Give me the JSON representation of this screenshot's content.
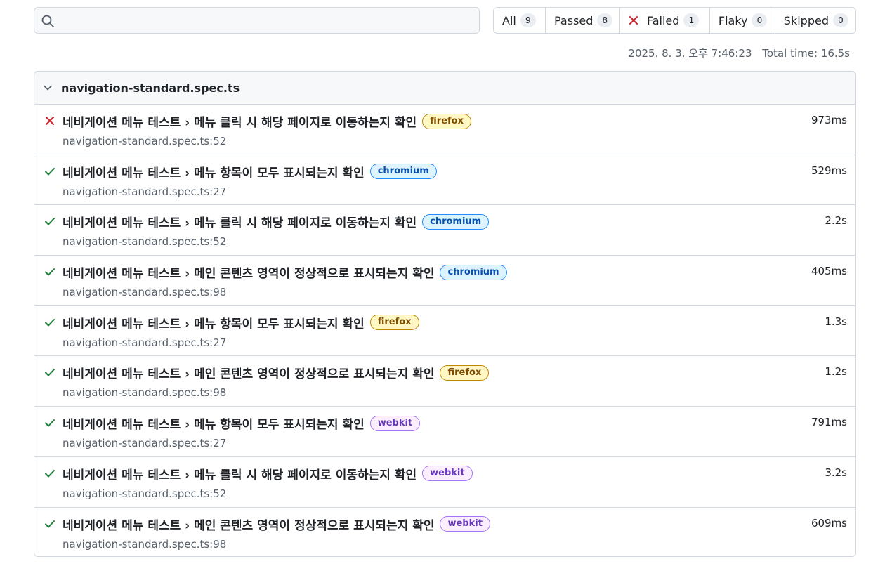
{
  "search": {
    "value": "",
    "placeholder": ""
  },
  "filters": [
    {
      "label": "All",
      "count": "9"
    },
    {
      "label": "Passed",
      "count": "8"
    },
    {
      "label": "Failed",
      "count": "1"
    },
    {
      "label": "Flaky",
      "count": "0"
    },
    {
      "label": "Skipped",
      "count": "0"
    }
  ],
  "meta": {
    "datetime": "2025. 8. 3. 오후 7:46:23",
    "total_time": "Total time: 16.5s"
  },
  "file": {
    "name": "navigation-standard.spec.ts",
    "tests": [
      {
        "status": "failed",
        "status_icon": "x-icon",
        "title": "네비게이션 메뉴 테스트 › 메뉴 클릭 시 해당 페이지로 이동하는지 확인",
        "browser": "firefox",
        "location": "navigation-standard.spec.ts:52",
        "duration": "973ms"
      },
      {
        "status": "passed",
        "status_icon": "check-icon",
        "title": "네비게이션 메뉴 테스트 › 메뉴 항목이 모두 표시되는지 확인",
        "browser": "chromium",
        "location": "navigation-standard.spec.ts:27",
        "duration": "529ms"
      },
      {
        "status": "passed",
        "status_icon": "check-icon",
        "title": "네비게이션 메뉴 테스트 › 메뉴 클릭 시 해당 페이지로 이동하는지 확인",
        "browser": "chromium",
        "location": "navigation-standard.spec.ts:52",
        "duration": "2.2s"
      },
      {
        "status": "passed",
        "status_icon": "check-icon",
        "title": "네비게이션 메뉴 테스트 › 메인 콘텐츠 영역이 정상적으로 표시되는지 확인",
        "browser": "chromium",
        "location": "navigation-standard.spec.ts:98",
        "duration": "405ms"
      },
      {
        "status": "passed",
        "status_icon": "check-icon",
        "title": "네비게이션 메뉴 테스트 › 메뉴 항목이 모두 표시되는지 확인",
        "browser": "firefox",
        "location": "navigation-standard.spec.ts:27",
        "duration": "1.3s"
      },
      {
        "status": "passed",
        "status_icon": "check-icon",
        "title": "네비게이션 메뉴 테스트 › 메인 콘텐츠 영역이 정상적으로 표시되는지 확인",
        "browser": "firefox",
        "location": "navigation-standard.spec.ts:98",
        "duration": "1.2s"
      },
      {
        "status": "passed",
        "status_icon": "check-icon",
        "title": "네비게이션 메뉴 테스트 › 메뉴 항목이 모두 표시되는지 확인",
        "browser": "webkit",
        "location": "navigation-standard.spec.ts:27",
        "duration": "791ms"
      },
      {
        "status": "passed",
        "status_icon": "check-icon",
        "title": "네비게이션 메뉴 테스트 › 메뉴 클릭 시 해당 페이지로 이동하는지 확인",
        "browser": "webkit",
        "location": "navigation-standard.spec.ts:52",
        "duration": "3.2s"
      },
      {
        "status": "passed",
        "status_icon": "check-icon",
        "title": "네비게이션 메뉴 테스트 › 메인 콘텐츠 영역이 정상적으로 표시되는지 확인",
        "browser": "webkit",
        "location": "navigation-standard.spec.ts:98",
        "duration": "609ms"
      }
    ]
  },
  "colors": {
    "passed": "#1a7f37",
    "failed": "#cf222e",
    "border": "#d0d7de",
    "muted": "#57606a"
  }
}
